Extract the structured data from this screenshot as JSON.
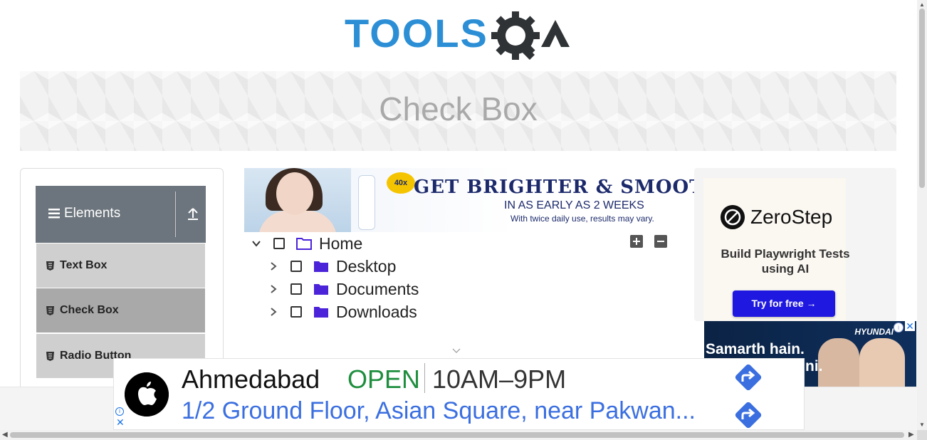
{
  "header": {
    "logo_text": "TOOLSQA",
    "page_title": "Check Box",
    "colors": {
      "logo_blue": "#2c8fd6",
      "logo_dark": "#2f3336"
    }
  },
  "sidebar": {
    "group_label": "Elements",
    "group_icon": "hamburger-icon",
    "collapse_icon": "upload-arrow-icon",
    "items": [
      {
        "label": "Text Box",
        "active": false
      },
      {
        "label": "Check Box",
        "active": true
      },
      {
        "label": "Radio Button",
        "active": false
      }
    ],
    "colors": {
      "header_bg": "#6c757d",
      "item_bg": "#cfcfcf",
      "active_bg": "#a9a9a9"
    }
  },
  "ad_top": {
    "headline": "GET BRIGHTER & SMOOTHER",
    "subline": "IN AS EARLY AS 2 WEEKS",
    "note": "With twice daily use, results may vary.",
    "badge": "40x"
  },
  "tree": {
    "expand_all_icon": "plus-square-icon",
    "collapse_all_icon": "minus-square-icon",
    "nodes": [
      {
        "label": "Home",
        "expanded": true,
        "checked": false,
        "level": 0
      },
      {
        "label": "Desktop",
        "expanded": false,
        "checked": false,
        "level": 1
      },
      {
        "label": "Documents",
        "expanded": false,
        "checked": false,
        "level": 1
      },
      {
        "label": "Downloads",
        "expanded": false,
        "checked": false,
        "level": 1
      }
    ],
    "colors": {
      "folder": "#4b23d8"
    }
  },
  "ad_right": {
    "brand": "ZeroStep",
    "tagline": "Build Playwright Tests using AI",
    "cta": "Try for free →",
    "colors": {
      "cta_bg": "#1f18e0"
    }
  },
  "ad_hyundai": {
    "brand": "HYUNDAI",
    "message_line1": "Samarth hain.",
    "message_line2": "ni."
  },
  "ad_bottom": {
    "city": "Ahmedabad",
    "status": "OPEN",
    "hours": "10AM–9PM",
    "address": "1/2 Ground Floor, Asian Square, near Pakwan...",
    "colors": {
      "open": "#1e8e3e",
      "address": "#3b6fe0",
      "direction": "#3b6fe0"
    }
  },
  "ad_controls": {
    "info_glyph": "i",
    "close_glyph": "✕"
  }
}
